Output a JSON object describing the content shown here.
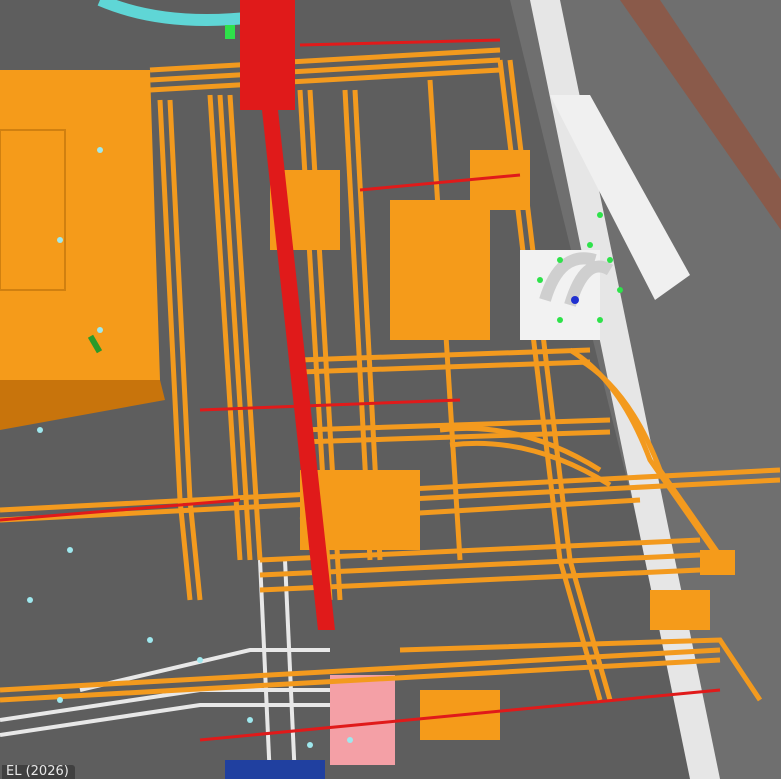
{
  "viewport": {
    "level_label": "EL (2026)",
    "colors": {
      "background": "#5a5a5a",
      "floor": "#6b6b6b",
      "cable_tray": "#f39a1e",
      "cable_tray_shade": "#c8740c",
      "equipment_block": "#f59b1a",
      "fire_pipe": "#e01a1a",
      "duct_white": "#f2f2f2",
      "steel_beam": "#8a5a4a",
      "selection_marker": "#2ee24a",
      "hanger_dot": "#9ee8ee",
      "pink_zone": "#f4a0a6",
      "cyan_duct": "#5fd6d6"
    }
  }
}
